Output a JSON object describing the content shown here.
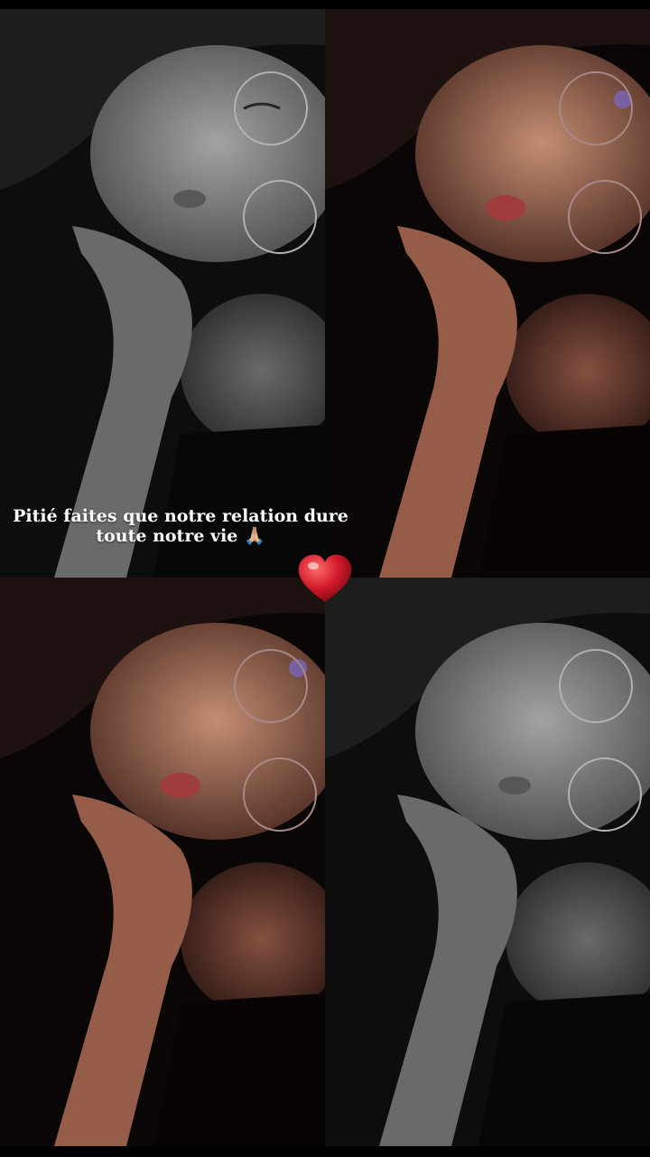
{
  "caption": {
    "line1": "Pitié faites que notre relation dure",
    "line2": "toute notre vie 🙏🏼"
  },
  "panels": [
    {
      "name": "photo-top-left",
      "style": "grayscale"
    },
    {
      "name": "photo-top-right",
      "style": "color"
    },
    {
      "name": "photo-bottom-left",
      "style": "color"
    },
    {
      "name": "photo-bottom-right",
      "style": "grayscale"
    }
  ],
  "colors": {
    "background": "#000000",
    "heart": "#d11a2a",
    "caption_text": "#ffffff"
  },
  "icons": [
    "heart-icon",
    "praying-hands-icon"
  ]
}
